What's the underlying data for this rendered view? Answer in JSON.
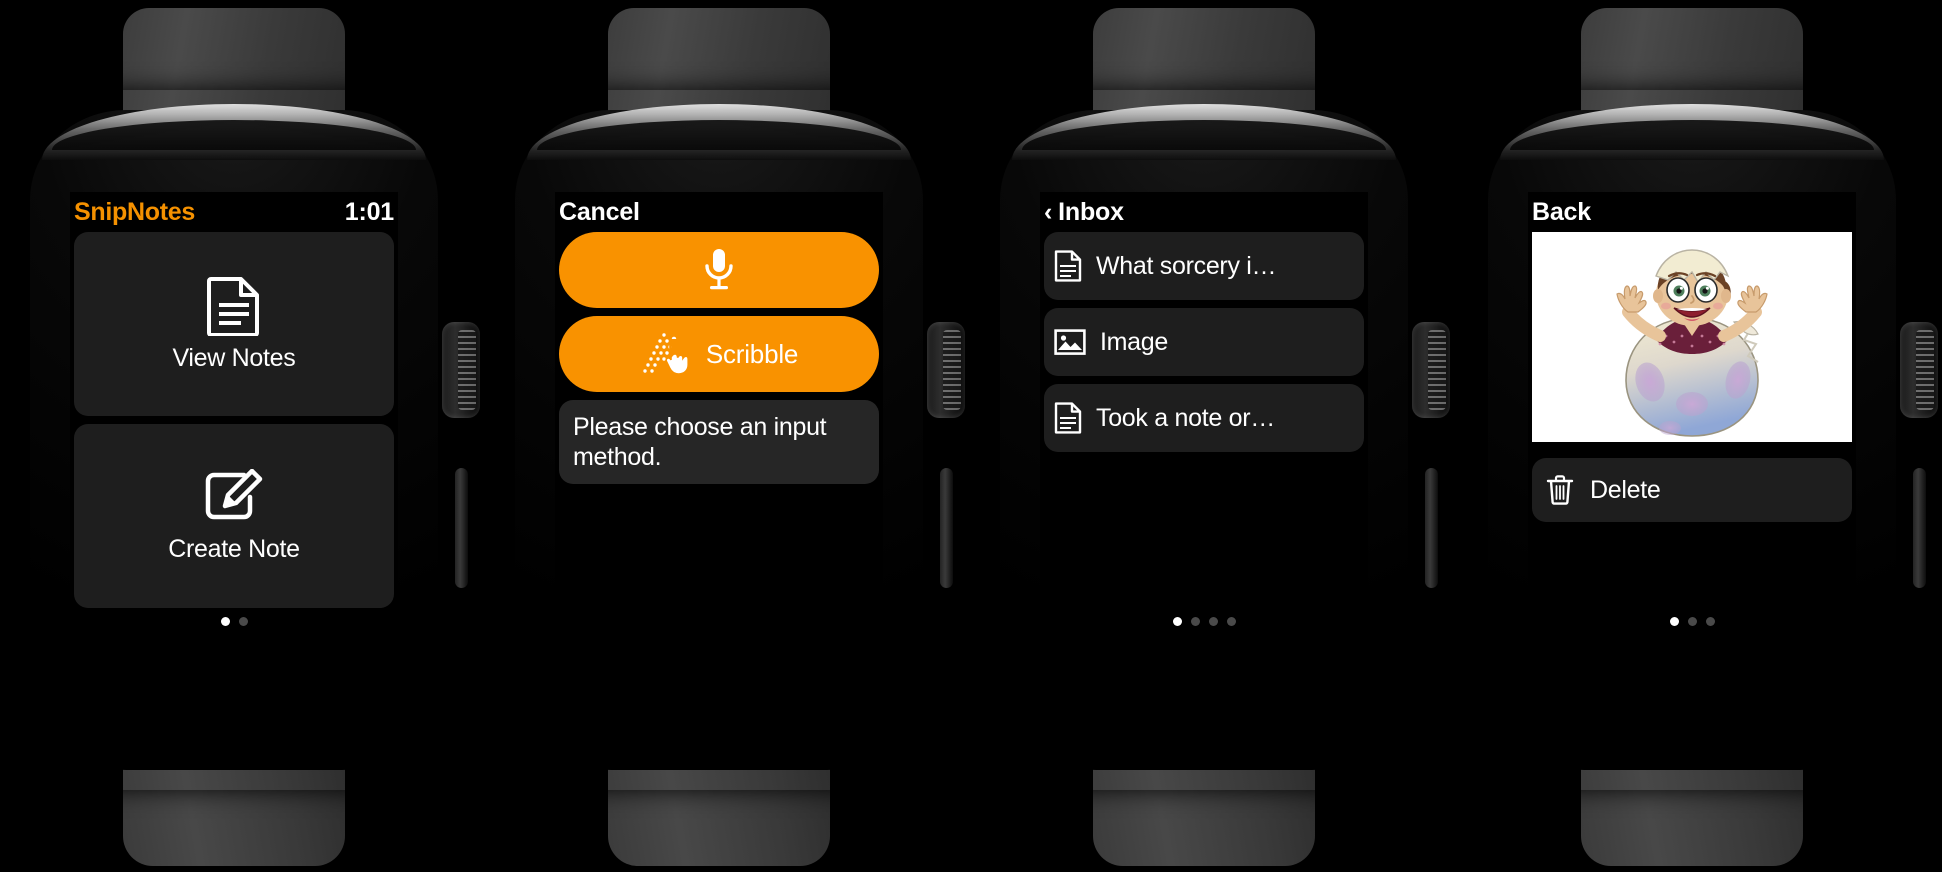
{
  "theme": {
    "accent_orange": "#f59100",
    "pill_orange": "#f99200",
    "card_gray": "#1e1e1e",
    "screen_black": "#000000",
    "text_white": "#ffffff",
    "dot_inactive": "#4a4a4a"
  },
  "watches": [
    {
      "id": "watch-main-menu",
      "status": {
        "app_title": "SnipNotes",
        "time": "1:01"
      },
      "menu_items": [
        {
          "icon": "document-icon",
          "label": "View Notes"
        },
        {
          "icon": "compose-note-icon",
          "label": "Create Note"
        }
      ],
      "page_dots": {
        "count": 2,
        "active_index": 0
      }
    },
    {
      "id": "watch-input-method",
      "nav": {
        "title": "Cancel"
      },
      "buttons": [
        {
          "icon": "microphone-icon",
          "label": ""
        },
        {
          "icon": "scribble-icon",
          "label": "Scribble"
        }
      ],
      "message": "Please choose an input method.",
      "page_dots": {
        "count": 0,
        "active_index": -1
      }
    },
    {
      "id": "watch-inbox-list",
      "nav": {
        "back_chevron": "‹",
        "title": "Inbox"
      },
      "rows": [
        {
          "icon": "document-icon",
          "label": "What sorcery i…"
        },
        {
          "icon": "image-icon",
          "label": "Image"
        },
        {
          "icon": "document-icon",
          "label": "Took a note or…"
        }
      ],
      "page_dots": {
        "count": 4,
        "active_index": 0
      }
    },
    {
      "id": "watch-note-detail",
      "nav": {
        "title": "Back"
      },
      "photo": {
        "alt": "cartoon boy hatching from a speckled egg"
      },
      "action": {
        "icon": "trash-icon",
        "label": "Delete"
      },
      "page_dots": {
        "count": 3,
        "active_index": 0
      }
    }
  ]
}
